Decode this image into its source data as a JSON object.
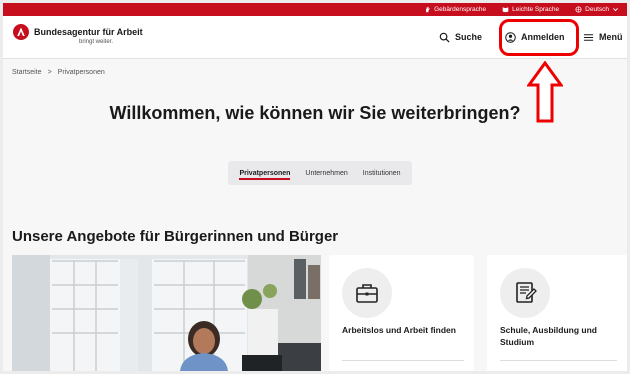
{
  "utility_bar": {
    "sign_language": "Gebärdensprache",
    "easy_language": "Leichte Sprache",
    "language": "Deutsch"
  },
  "header": {
    "brand_name": "Bundesagentur für Arbeit",
    "brand_tagline": "bringt weiter.",
    "search_label": "Suche",
    "login_label": "Anmelden",
    "menu_label": "Menü"
  },
  "breadcrumb": {
    "home": "Startseite",
    "separator": ">",
    "current": "Privatpersonen"
  },
  "hero": {
    "headline": "Willkommen, wie können wir Sie weiterbringen?"
  },
  "tabs": [
    {
      "label": "Privatpersonen",
      "active": true
    },
    {
      "label": "Unternehmen",
      "active": false
    },
    {
      "label": "Institutionen",
      "active": false
    }
  ],
  "offers": {
    "heading": "Unsere Angebote für Bürgerinnen und Bürger",
    "cards": [
      {
        "label": "Arbeitslos und Arbeit finden",
        "icon": "briefcase-icon"
      },
      {
        "label": "Schule, Ausbildung und Studium",
        "icon": "certificate-icon"
      }
    ]
  },
  "colors": {
    "brand_red": "#c70e1e",
    "annotation_red": "#ee0000"
  }
}
